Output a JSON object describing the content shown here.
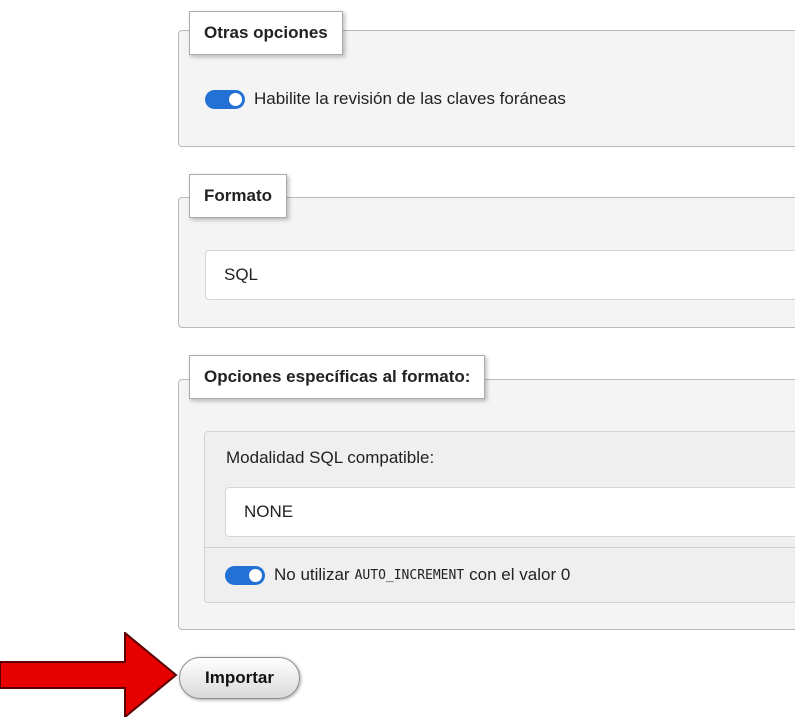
{
  "other_options": {
    "title": "Otras opciones",
    "foreign_key_check": {
      "label": "Habilite la revisión de las claves foráneas",
      "enabled": true
    }
  },
  "format": {
    "title": "Formato",
    "selected": "SQL"
  },
  "format_specific": {
    "title": "Opciones específicas al formato:",
    "sql_compat_label": "Modalidad SQL compatible:",
    "sql_compat_selected": "NONE",
    "no_auto_increment": {
      "prefix": "No utilizar",
      "code": "AUTO_INCREMENT",
      "suffix": "con el valor 0",
      "enabled": true
    }
  },
  "import_button": {
    "label": "Importar"
  },
  "colors": {
    "toggle_on": "#2471d6",
    "annotation_arrow": "#e60000"
  },
  "icons": {
    "annotation": "red-arrow-right-icon"
  }
}
